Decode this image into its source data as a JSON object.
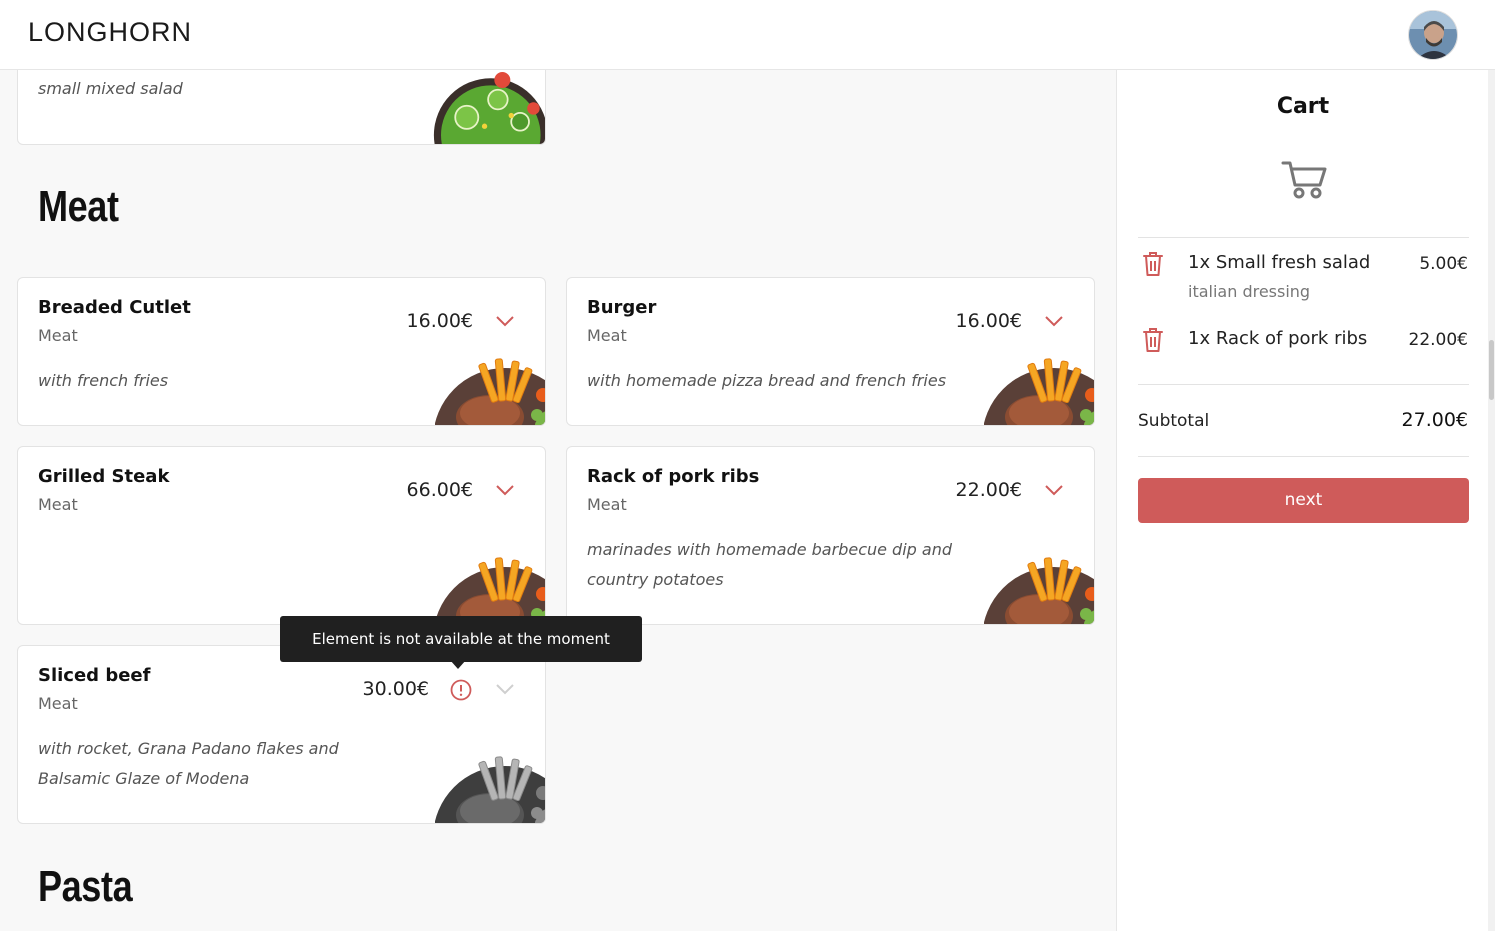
{
  "app": {
    "logo": "LONGHORN"
  },
  "sections": {
    "meat_title": "Meat",
    "pasta_title": "Pasta"
  },
  "items": {
    "salad": {
      "description": "small mixed salad"
    },
    "breaded_cutlet": {
      "name": "Breaded Cutlet",
      "category": "Meat",
      "price": "16.00€",
      "description": "with french fries"
    },
    "burger": {
      "name": "Burger",
      "category": "Meat",
      "price": "16.00€",
      "description": "with homemade pizza bread and french fries"
    },
    "grilled_steak": {
      "name": "Grilled Steak",
      "category": "Meat",
      "price": "66.00€",
      "description": ""
    },
    "pork_ribs": {
      "name": "Rack of pork ribs",
      "category": "Meat",
      "price": "22.00€",
      "description": "marinades with homemade barbecue dip and country potatoes"
    },
    "sliced_beef": {
      "name": "Sliced beef",
      "category": "Meat",
      "price": "30.00€",
      "description": "with rocket, Grana Padano flakes and Balsamic Glaze of Modena",
      "available": false
    }
  },
  "tooltip": {
    "text": "Element is not available at the moment"
  },
  "cart": {
    "title": "Cart",
    "items": [
      {
        "label": "1x Small fresh salad",
        "note": "italian dressing",
        "price": "5.00€"
      },
      {
        "label": "1x Rack of pork ribs",
        "note": "",
        "price": "22.00€"
      }
    ],
    "subtotal_label": "Subtotal",
    "subtotal_value": "27.00€",
    "next_label": "next"
  },
  "colors": {
    "accent": "#cf5b5a",
    "dark": "#202020",
    "background": "#f8f8f8"
  },
  "icons": [
    "chevron-down-icon",
    "info-icon",
    "trash-icon",
    "cart-icon",
    "dish-image",
    "salad-image",
    "avatar"
  ]
}
